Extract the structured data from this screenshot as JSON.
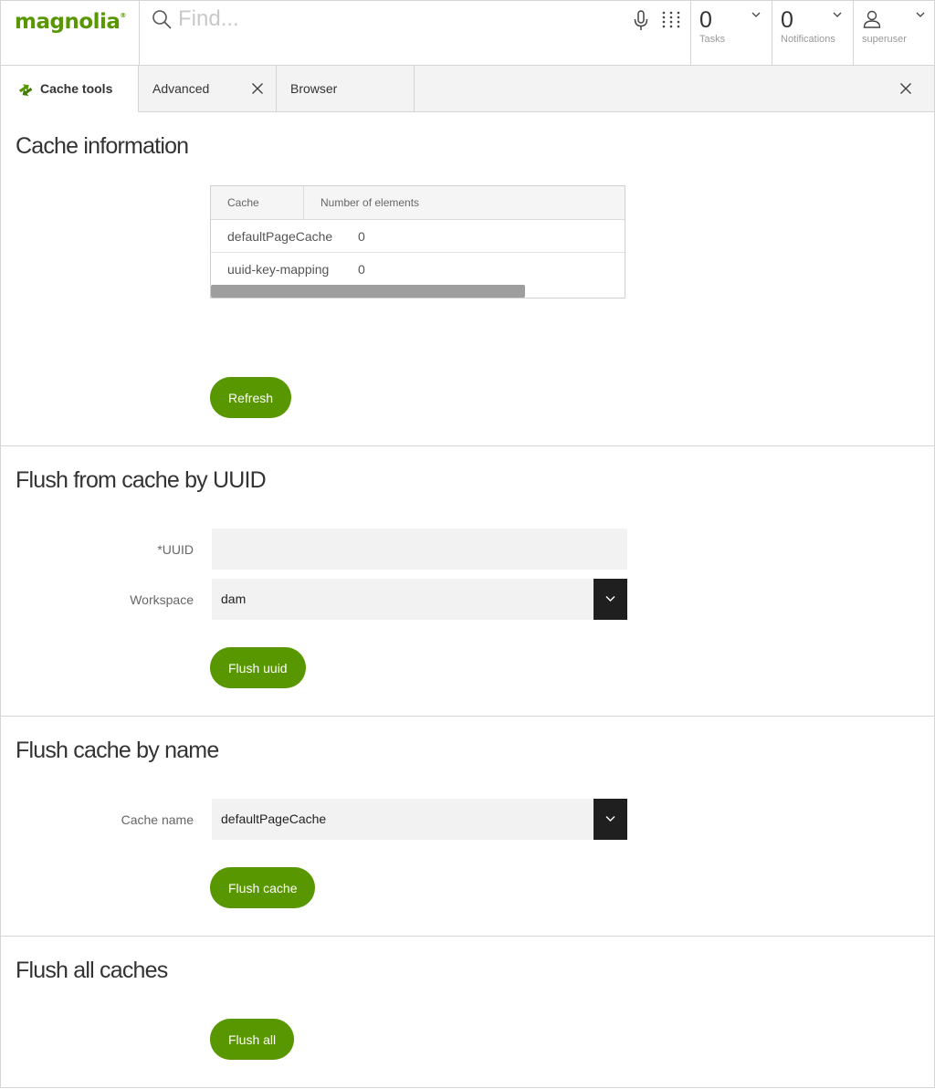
{
  "header": {
    "logo_text": "magnolia",
    "logo_mark": "®",
    "search_placeholder": "Find...",
    "tasks": {
      "count": "0",
      "label": "Tasks"
    },
    "notifications": {
      "count": "0",
      "label": "Notifications"
    },
    "user": {
      "label": "superuser"
    },
    "icons": {
      "search": "search-icon",
      "mic": "microphone-icon",
      "apps": "app-grid-icon",
      "user": "user-icon"
    }
  },
  "tabs": [
    {
      "label": "Cache tools",
      "active": true
    },
    {
      "label": "Advanced",
      "active": false,
      "closable": true
    },
    {
      "label": "Browser",
      "active": false
    }
  ],
  "cache_info": {
    "title": "Cache information",
    "columns": [
      "Cache",
      "Number of elements"
    ],
    "rows": [
      {
        "cache": "defaultPageCache",
        "count": "0"
      },
      {
        "cache": "uuid-key-mapping",
        "count": "0"
      }
    ],
    "refresh_label": "Refresh"
  },
  "flush_uuid": {
    "title": "Flush from cache by UUID",
    "uuid_label": "*UUID",
    "uuid_value": "",
    "workspace_label": "Workspace",
    "workspace_value": "dam",
    "button_label": "Flush uuid"
  },
  "flush_name": {
    "title": "Flush cache by name",
    "cache_name_label": "Cache name",
    "cache_name_value": "defaultPageCache",
    "button_label": "Flush cache"
  },
  "flush_all": {
    "title": "Flush all caches",
    "button_label": "Flush all"
  },
  "colors": {
    "accent": "#599700",
    "select_button": "#1f1f1f",
    "field_bg": "#f2f2f2"
  }
}
